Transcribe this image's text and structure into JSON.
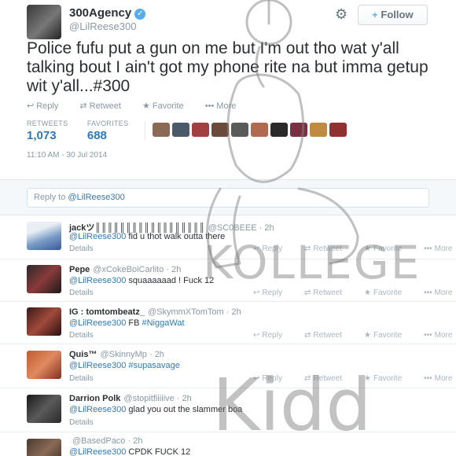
{
  "header": {
    "fullname": "300Agency",
    "verified_mark": "✓",
    "screen_name": "@LilReese300",
    "follow_label": "Follow",
    "follow_icon": "+",
    "gear_icon": "⚙"
  },
  "tweet": {
    "text": "Police fufu put a gun on me but I'm out tho wat y'all talking bout I ain't got my phone rite na but imma getup wit y'all...#300",
    "actions": {
      "reply": "Reply",
      "retweet": "Retweet",
      "favorite": "Favorite",
      "more": "More"
    },
    "retweets_label": "RETWEETS",
    "retweets_count": "1,073",
    "favorites_label": "FAVORITES",
    "favorites_count": "688",
    "timestamp": "11:10 AM - 30 Jul 2014"
  },
  "reply_box": {
    "prefix": "Reply to ",
    "mention": "@LilReese300"
  },
  "replies": [
    {
      "name": "jackツ║║║║║║║║║║║║║║║║║║",
      "handle": "@SC0BEEE · 2h",
      "mention": "@LilReese300",
      "text": " fid u thot walk outta there",
      "tag": "",
      "details": "Details"
    },
    {
      "name": "Pepe",
      "handle": "@xCokeBoiCarlito · 2h",
      "mention": "@LilReese300",
      "text": " squaaaaaad ! Fuck 12",
      "tag": "",
      "details": "Details"
    },
    {
      "name": "IG : tomtombeatz_",
      "handle": "@SkymmXTomTom · 2h",
      "mention": "@LilReese300",
      "text": " FB ",
      "tag": "#NiggaWat",
      "details": "Details"
    },
    {
      "name": "Quis™",
      "handle": "@SkinnyMp · 2h",
      "mention": "@LilReese300",
      "text": " ",
      "tag": "#supasavage",
      "details": "Details"
    },
    {
      "name": "Darrion Polk",
      "handle": "@stopitfiiiiive · 2h",
      "mention": "@LilReese300",
      "text": " glad you out the slammer boa",
      "tag": "",
      "details": "Details"
    },
    {
      "name": "",
      "handle": "@BasedPaco · 2h",
      "mention": "@LilReese300",
      "text": " CPDK FUCK 12",
      "tag": "",
      "details": ""
    }
  ],
  "reply_actions": {
    "reply": "Reply",
    "retweet": "Retweet",
    "favorite": "Favorite",
    "more": "More"
  },
  "watermark": {
    "word1": "KOLLEGE",
    "word2": "Kidd"
  },
  "colors": {
    "link": "#2b7bb9",
    "verified": "#55acee",
    "muted": "#8899a6"
  }
}
